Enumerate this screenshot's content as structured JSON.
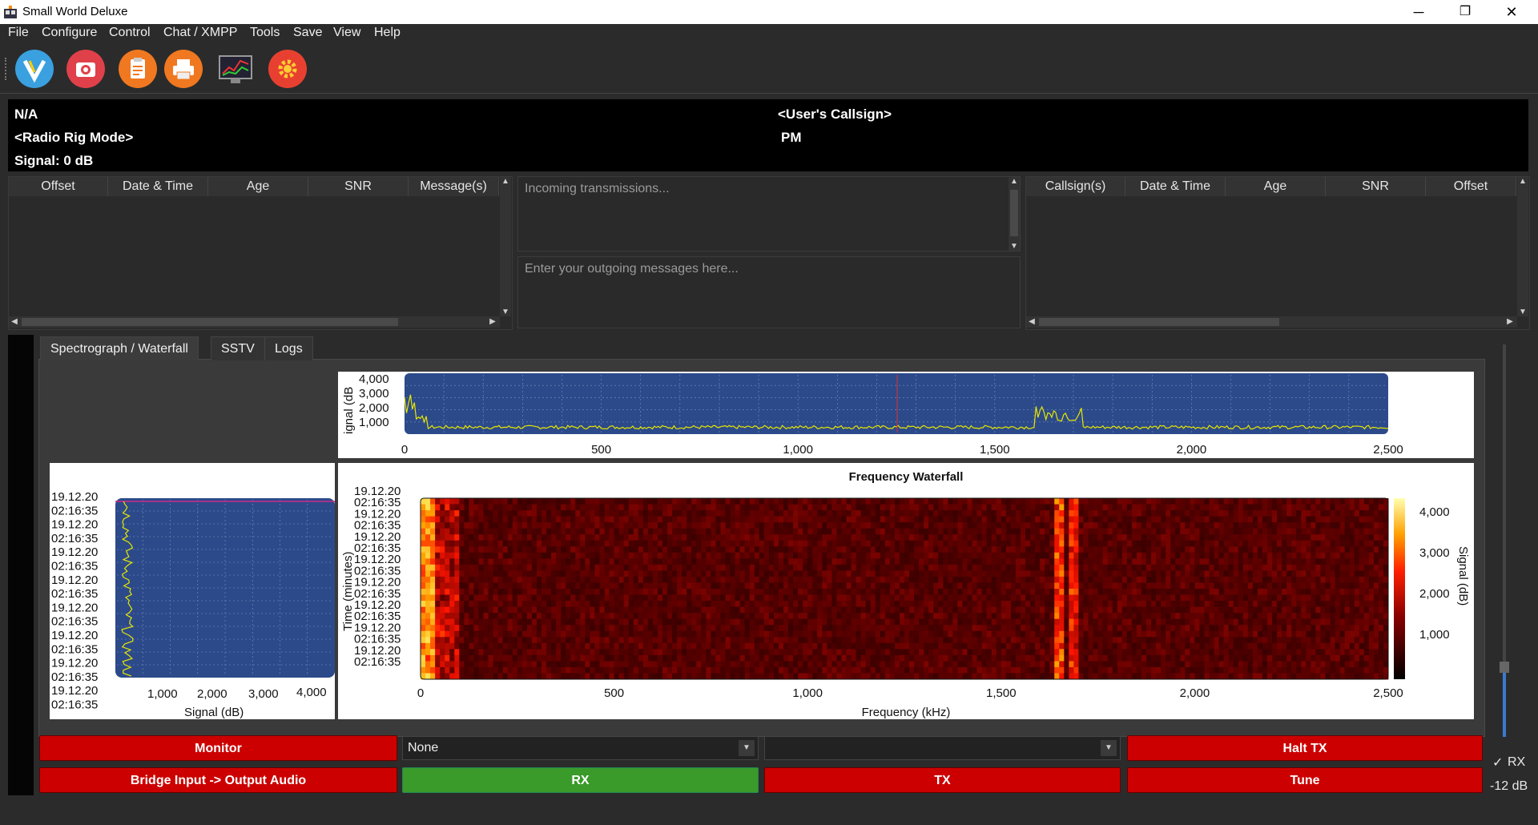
{
  "window": {
    "title": "Small World Deluxe",
    "minimize": "─",
    "maximize": "❐",
    "close": "✕"
  },
  "menu": [
    "File",
    "Configure",
    "Control",
    "Chat / XMPP",
    "Tools",
    "Save",
    "View",
    "Help"
  ],
  "toolbar": {
    "icons": [
      "app-logo-icon",
      "camera-icon",
      "clipboard-icon",
      "printer-icon",
      "chart-monitor-icon",
      "settings-gear-icon"
    ]
  },
  "info": {
    "frequency": "N/A",
    "rig_mode": "<Radio Rig Mode>",
    "signal": "Signal: 0 dB",
    "callsign": "<User's Callsign>",
    "time_period": "PM"
  },
  "left_table": {
    "columns": [
      "Offset",
      "Date & Time",
      "Age",
      "SNR",
      "Message(s)"
    ]
  },
  "incoming": {
    "placeholder": "Incoming transmissions..."
  },
  "outgoing": {
    "placeholder": "Enter your outgoing messages here..."
  },
  "right_table": {
    "columns": [
      "Callsign(s)",
      "Date & Time",
      "Age",
      "SNR",
      "Offset"
    ]
  },
  "tabs": [
    "Spectrograph / Waterfall",
    "SSTV",
    "Logs"
  ],
  "spectro": {
    "ylabel": "ignal (dB",
    "y_ticks": [
      "4,000",
      "3,000",
      "2,000",
      "1,000"
    ],
    "x_ticks": [
      "0",
      "500",
      "1,000",
      "1,500",
      "2,000",
      "2,500"
    ]
  },
  "signal_plot": {
    "xlabel": "Signal (dB)",
    "x_ticks": [
      "1,000",
      "2,000",
      "3,000",
      "4,000"
    ],
    "time_ticks": [
      "19.12.20",
      "02:16:35",
      "19.12.20",
      "02:16:35",
      "19.12.20",
      "02:16:35",
      "19.12.20",
      "02:16:35",
      "19.12.20",
      "02:16:35",
      "19.12.20",
      "02:16:35",
      "19.12.20",
      "02:16:35",
      "19.12.20",
      "02:16:35"
    ]
  },
  "waterfall": {
    "title": "Frequency Waterfall",
    "xlabel": "Frequency (kHz)",
    "ylabel": "Time (minutes)",
    "colorbar_label": "Signal (dB)",
    "colorbar_ticks": [
      "4,000",
      "3,000",
      "2,000",
      "1,000"
    ],
    "x_ticks": [
      "0",
      "500",
      "1,000",
      "1,500",
      "2,000",
      "2,500"
    ],
    "time_ticks": [
      "19.12.20",
      "02:16:35",
      "19.12.20",
      "02:16:35",
      "19.12.20",
      "02:16:35",
      "19.12.20",
      "02:16:35",
      "19.12.20",
      "02:16:35",
      "19.12.20",
      "02:16:35",
      "19.12.20",
      "02:16:35",
      "19.12.20",
      "02:16:35"
    ]
  },
  "controls": {
    "monitor": "Monitor",
    "bridge": "Bridge Input -> Output Audio",
    "combo1": "None",
    "combo2": "",
    "rx": "RX",
    "tx": "TX",
    "halt_tx": "Halt TX",
    "tune": "Tune"
  },
  "side": {
    "rx_check": "✓",
    "rx_label": "RX",
    "db_label": "-12 dB"
  },
  "colors": {
    "accent_red": "#cc0000",
    "accent_green": "#3a9a2a",
    "plot_bg": "#2c4a8a",
    "trace": "#e6e600"
  }
}
